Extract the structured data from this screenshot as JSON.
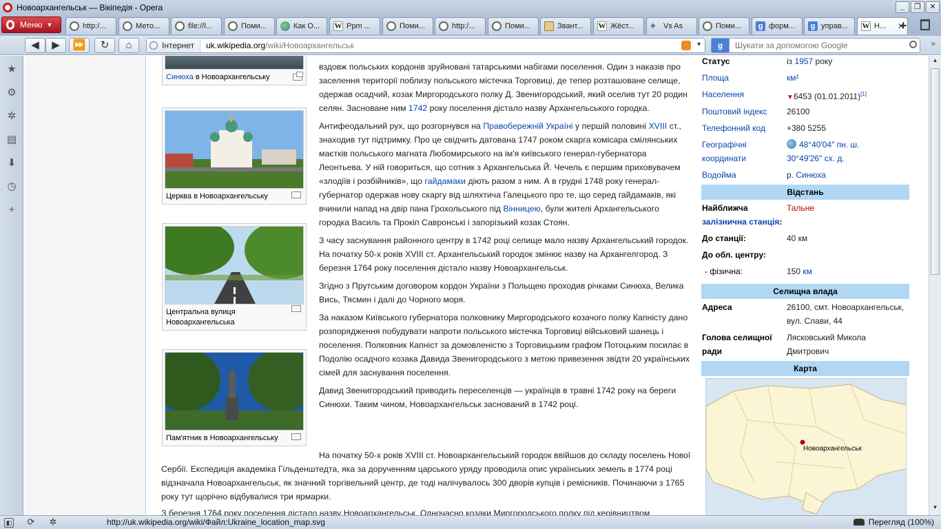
{
  "window": {
    "title": "Новоархангельськ — Вікіпедія - Opera"
  },
  "menu": {
    "label": "Меню"
  },
  "tabs": [
    {
      "label": "http:/...",
      "icon": "page-icon"
    },
    {
      "label": "Мето...",
      "icon": "page-icon"
    },
    {
      "label": "file://l...",
      "icon": "page-icon"
    },
    {
      "label": "Поми...",
      "icon": "page-icon"
    },
    {
      "label": "Как О...",
      "icon": "globe-icon"
    },
    {
      "label": "Ppm ...",
      "icon": "wikipedia-icon"
    },
    {
      "label": "Поми...",
      "icon": "page-icon"
    },
    {
      "label": "http:/...",
      "icon": "page-icon"
    },
    {
      "label": "Поми...",
      "icon": "page-icon"
    },
    {
      "label": "Звант...",
      "icon": "download-icon"
    },
    {
      "label": "Жёст...",
      "icon": "wikipedia-icon"
    },
    {
      "label": "Vs As",
      "icon": "vk-icon"
    },
    {
      "label": "Поми...",
      "icon": "page-icon"
    },
    {
      "label": "форм...",
      "icon": "google-icon"
    },
    {
      "label": "управ...",
      "icon": "google-icon"
    },
    {
      "label": "Н...",
      "icon": "wikipedia-icon"
    }
  ],
  "address": {
    "security_label": "Інтернет",
    "url_domain": "uk.wikipedia.org",
    "url_path": "/wiki/Новоархангельськ"
  },
  "search": {
    "engine": "g",
    "placeholder": "Шукати за допомогою Google"
  },
  "thumbnails": [
    {
      "caption_link": "Синюха",
      "caption_rest": " в Новоархангельську"
    },
    {
      "caption": "Церква в Новоархангельську"
    },
    {
      "caption": "Центральна вулиця Новоархангельська"
    },
    {
      "caption": "Пам'ятник в Новоархангельську"
    }
  ],
  "article": {
    "p1": "вздовж польських кордонів зруйновані татарськими набігами поселення. Один з наказів про заселення території поблизу польського містечка Торговиці, де тепер розташоване селище, одержав осадчий, козак Миргородського полку Д. Звенигородський, який оселив тут 20 родин селян. Засноване ним ",
    "p1_link": "1742",
    "p1_end": " року поселення дістало назву Архангельського городка.",
    "p2_a": "Антифеодальний рух, що розгорнувся на ",
    "p2_link1": "Правобережній Україні",
    "p2_b": " у першій половині ",
    "p2_link2": "XVIII",
    "p2_c": " ст., знаходив тут підтримку. Про це свідчить датована 1747 роком скарга комісара смілянських маєтків польського магната Любомирського на ім'я київського генерал-губернатора Леонтьева. У ній говориться, що сотник з Архангельська Й. Чечель є першим приховувачем «злодіїв і розбійників», що ",
    "p2_link3": "гайдамаки",
    "p2_d": " діють разом з ним. А в грудні 1748 року генерал-губернатор одержав нову скаргу від шляхтича Галецького про те, що серед гайдамаків, які вчинили напад на двір пана Грохольського під ",
    "p2_link4": "Вінницею",
    "p2_e": ", були жителі Архангельського городка Василь та Прокіп Савронські і запорізький козак Стоян.",
    "p3": "З часу заснування районного центру в 1742 році селище мало назву Архангельський городок. На початку 50-х років XVIII ст. Архангельський городок змінює назву на Архангелгород. З березня 1764 року поселення дістало назву Новоархангельськ.",
    "p4": "Згідно з Прутським договором кордон України з Польщею проходив річками Синюха, Велика Вись, Тясмин і далі до Чорного моря.",
    "p5": "За наказом Київського губернатора полковнику Миргородського козачого полку Капністу дано розпорядження побудувати напроти польського містечка Торговиці військовий шанець і поселення. Полковник Капніст за домовленістю з Торговицьким графом Потоцьким посилає в Подолію осадчого козака Давида Звенигородського з метою привезення звідти 20 українських сімей для заснування поселення.",
    "p6": "Давид Звенигородський приводить переселенців — українців в травні 1742 року на береги Синюхи. Таким чином, Новоархангельськ заснований в 1742 році.",
    "p7": "На початку 50-х років XVIII ст. Новоархангельський городок ввійшов до складу поселень Нової Сербії. Експедиція академіка Гільденштедта, яка за дорученням царського уряду проводила опис українських земель в 1774 році відзначала Новоархангельськ, як значний торгівельний центр, де тоді налічувалось 300 дворів купців і ремісників. Починаючи з 1765 року тут щорічно відбувалися три ярмарки.",
    "p8": "З березня 1764 року поселення дістало назву Новоархангельськ. Одночасно козаки Миргородського полку під керівництвом"
  },
  "infobox": {
    "status_k": "Статус",
    "status_v1": "із ",
    "status_link": "1957",
    "status_v2": " року",
    "area_k": "Площа",
    "area_v": "км²",
    "pop_k": "Населення",
    "pop_v": "6453 (01.01.2011)",
    "pop_ref": "[1]",
    "postal_k": "Поштовий індекс",
    "postal_v": "26100",
    "phone_k": "Телефонний код",
    "phone_v": "+380 5255",
    "geo_k1": "Географічні",
    "geo_k2": "координати",
    "geo_v1": "48°40′04″ пн. ш.",
    "geo_v2": "30°49′26″ сх. д.",
    "water_k": "Водойма",
    "water_v1": "р. ",
    "water_link": "Синюха",
    "distance_head": "Відстань",
    "near_k1": "Найближча",
    "near_k2": "залізнична станція",
    "near_k3": ":",
    "near_v": "Тальне",
    "tostation_k": "До станції:",
    "tostation_v": "40 км",
    "tocenter_k": "До обл. центру:",
    "phys_k": "- фізична:",
    "phys_v": "150 ",
    "phys_link": "км",
    "council_head": "Селищна влада",
    "addr_k": "Адреса",
    "addr_v1": "26100, смт. Новоархангельськ,",
    "addr_v2": "вул. Слави, 44",
    "head_k1": "Голова селищної",
    "head_k2": "ради",
    "head_v1": "Лясковський Микола",
    "head_v2": "Дмитрович",
    "map_head": "Карта",
    "map_label": "Новоархангельськ"
  },
  "statusbar": {
    "url": "http://uk.wikipedia.org/wiki/Файл:Ukraine_location_map.svg",
    "zoom": "Перегляд (100%)"
  }
}
